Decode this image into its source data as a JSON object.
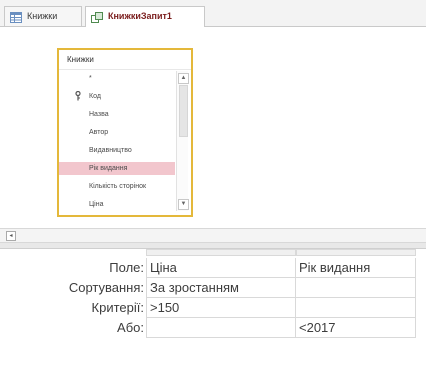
{
  "tabs": [
    {
      "label": "Книжки",
      "icon": "table-icon",
      "active": false
    },
    {
      "label": "КнижкиЗапит1",
      "icon": "query-icon",
      "active": true
    }
  ],
  "field_list": {
    "title": "Книжки",
    "items": [
      {
        "label": "*",
        "key": false,
        "selected": false
      },
      {
        "label": "Код",
        "key": true,
        "selected": false
      },
      {
        "label": "Назва",
        "key": false,
        "selected": false
      },
      {
        "label": "Автор",
        "key": false,
        "selected": false
      },
      {
        "label": "Видавництво",
        "key": false,
        "selected": false
      },
      {
        "label": "Рік видання",
        "key": false,
        "selected": true
      },
      {
        "label": "Кількість сторінок",
        "key": false,
        "selected": false
      },
      {
        "label": "Ціна",
        "key": false,
        "selected": false
      }
    ]
  },
  "qbe": {
    "row_labels": [
      "Поле:",
      "Сортування:",
      "Критерії:",
      "Або:"
    ],
    "columns": [
      {
        "field": "Ціна",
        "sort": "За зростанням",
        "criteria": ">150",
        "or": ""
      },
      {
        "field": "Рік видання",
        "sort": "",
        "criteria": "",
        "or": "<2017"
      }
    ]
  },
  "colors": {
    "field_list_border": "#e4b83a",
    "selected_row": "#f2c6cd",
    "active_tab_text": "#7a1c1c"
  }
}
